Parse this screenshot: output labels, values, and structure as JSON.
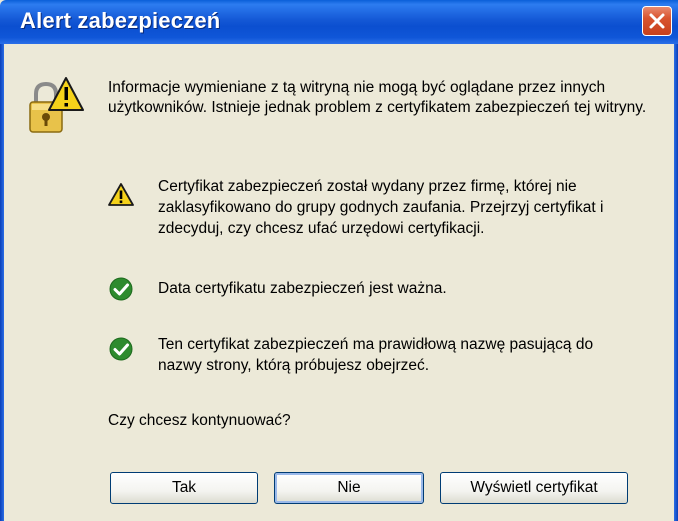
{
  "window": {
    "title": "Alert zabezpieczeń"
  },
  "dialog": {
    "intro": "Informacje wymieniane z tą witryną nie mogą być oglądane przez innych użytkowników. Istnieje jednak problem z certyfikatem zabezpieczeń tej witryny.",
    "items": [
      {
        "icon": "warning-icon",
        "text": "Certyfikat zabezpieczeń został wydany przez firmę, której nie zaklasyfikowano do grupy godnych zaufania. Przejrzyj certyfikat i zdecyduj, czy chcesz ufać urzędowi certyfikacji."
      },
      {
        "icon": "check-icon",
        "text": "Data certyfikatu zabezpieczeń jest ważna."
      },
      {
        "icon": "check-icon",
        "text": "Ten certyfikat zabezpieczeń ma prawidłową nazwę pasującą do nazwy strony, którą próbujesz obejrzeć."
      }
    ],
    "question": "Czy chcesz kontynuować?"
  },
  "buttons": {
    "yes_label": "Tak",
    "no_label": "Nie",
    "view_certificate_label": "Wyświetl certyfikat"
  },
  "colors": {
    "titlebar": "#0b4fd0",
    "dialog_background": "#ece9d8",
    "close_button": "#d9542f",
    "warning": "#f5d21a",
    "check": "#2e8b2e"
  }
}
